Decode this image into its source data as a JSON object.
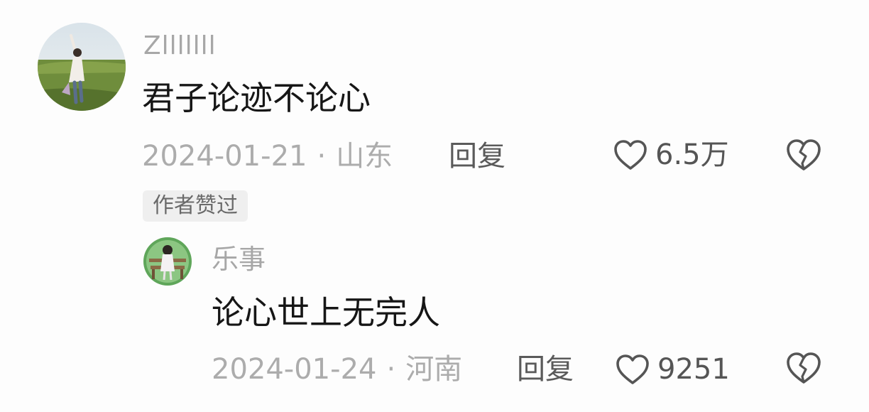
{
  "comment": {
    "username": "Zlllllll",
    "text": "君子论迹不论心",
    "date": "2024-01-21",
    "separator": "·",
    "location": "山东",
    "reply_label": "回复",
    "likes": "6.5万",
    "author_badge": "作者赞过"
  },
  "reply": {
    "username": "乐事",
    "text": "论心世上无完人",
    "date": "2024-01-24",
    "separator": "·",
    "location": "河南",
    "reply_label": "回复",
    "likes": "9251"
  },
  "icons": {
    "like": "heart-outline-icon",
    "dislike": "broken-heart-icon"
  },
  "colors": {
    "username": "#a7a7a7",
    "text": "#161616",
    "meta": "#acacac",
    "action": "#555555",
    "badge_bg": "#efefef"
  }
}
